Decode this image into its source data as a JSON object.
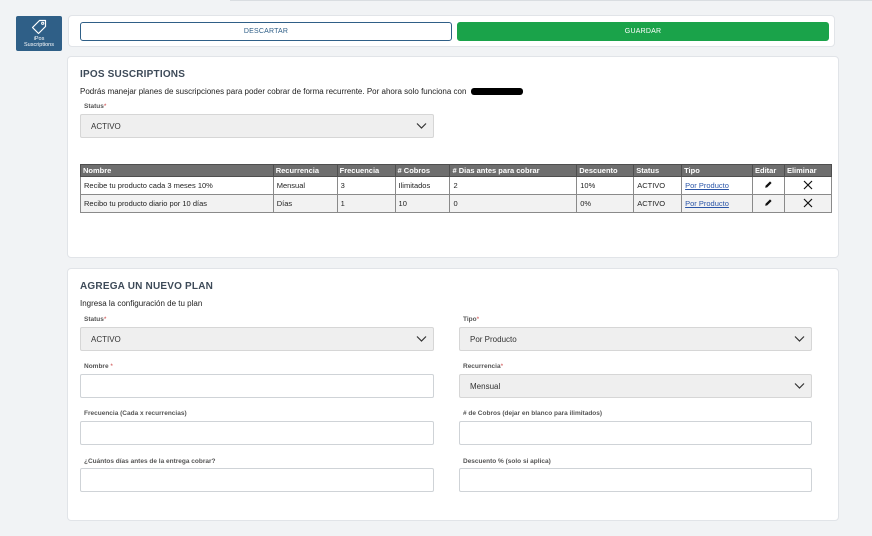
{
  "app_tile": {
    "icon": "tag-icon",
    "label_line1": "iPos",
    "label_line2": "Suscriptions"
  },
  "actions": {
    "discard_label": "DESCARTAR",
    "save_label": "GUARDAR"
  },
  "list_section": {
    "title": "IPOS SUSCRIPTIONS",
    "description": "Podrás manejar planes de suscripciones para poder cobrar de forma recurrente. Por ahora solo funciona con",
    "status_label": "Status",
    "status_value": "ACTIVO",
    "table": {
      "headers": [
        "Nombre",
        "Recurrencia",
        "Frecuencia",
        "# Cobros",
        "# Dias antes para cobrar",
        "Descuento",
        "Status",
        "Tipo",
        "Editar",
        "Eliminar"
      ],
      "rows": [
        {
          "nombre": "Recibe tu producto cada 3 meses 10%",
          "recurrencia": "Mensual",
          "frecuencia": "3",
          "cobros": "Ilimitados",
          "dias": "2",
          "descuento": "10%",
          "status": "ACTIVO",
          "tipo": "Por Producto"
        },
        {
          "nombre": "Recibo tu producto diario por 10 días",
          "recurrencia": "Días",
          "frecuencia": "1",
          "cobros": "10",
          "dias": "0",
          "descuento": "0%",
          "status": "ACTIVO",
          "tipo": "Por Producto"
        }
      ]
    }
  },
  "new_plan": {
    "title": "AGREGA UN NUEVO PLAN",
    "description": "Ingresa la configuración de tu plan",
    "fields": {
      "status": {
        "label": "Status",
        "value": "ACTIVO"
      },
      "tipo": {
        "label": "Tipo",
        "value": "Por Producto"
      },
      "nombre": {
        "label": "Nombre ",
        "value": ""
      },
      "recurrencia": {
        "label": "Recurrencia",
        "value": "Mensual"
      },
      "frecuencia": {
        "label": "Frecuencia (Cada x recurrencias)",
        "value": ""
      },
      "cobros": {
        "label": "# de Cobros (dejar en blanco para ilimitados)",
        "value": ""
      },
      "dias": {
        "label": "¿Cuántos días antes de la entrega cobrar?",
        "value": ""
      },
      "descuento": {
        "label": "Descuento % (solo si aplica)",
        "value": ""
      }
    }
  },
  "required_mark": "*"
}
